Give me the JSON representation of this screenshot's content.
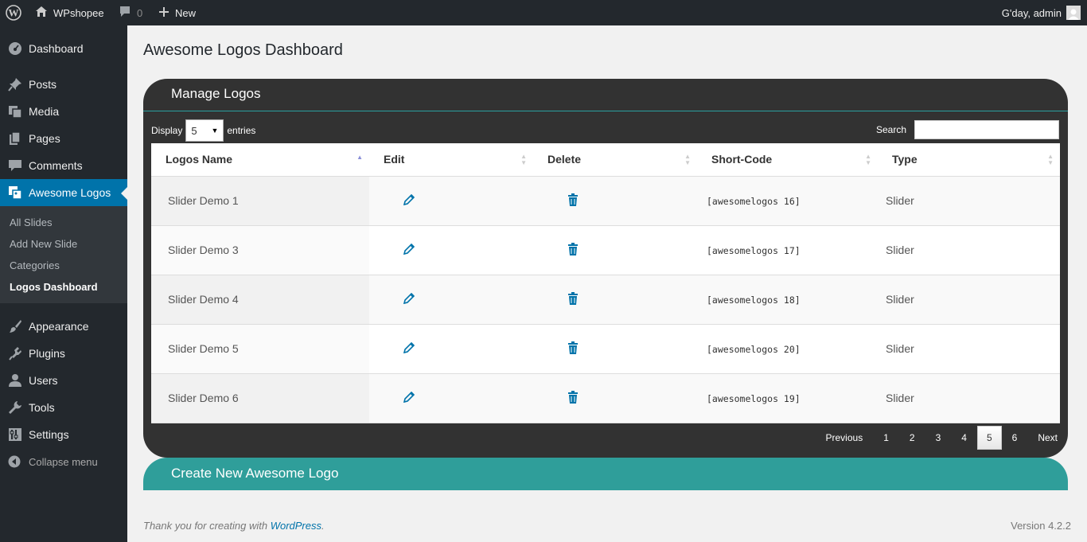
{
  "adminbar": {
    "site_name": "WPshopee",
    "comments_count": "0",
    "new_label": "New",
    "greeting": "G'day, admin"
  },
  "sidebar": {
    "items": [
      {
        "label": "Dashboard",
        "icon": "dashboard-icon"
      },
      {
        "label": "Posts",
        "icon": "pin-icon"
      },
      {
        "label": "Media",
        "icon": "media-icon"
      },
      {
        "label": "Pages",
        "icon": "pages-icon"
      },
      {
        "label": "Comments",
        "icon": "comment-icon"
      },
      {
        "label": "Awesome Logos",
        "icon": "images-icon"
      },
      {
        "label": "Appearance",
        "icon": "brush-icon"
      },
      {
        "label": "Plugins",
        "icon": "plugin-icon"
      },
      {
        "label": "Users",
        "icon": "users-icon"
      },
      {
        "label": "Tools",
        "icon": "wrench-icon"
      },
      {
        "label": "Settings",
        "icon": "settings-icon"
      }
    ],
    "submenu": [
      "All Slides",
      "Add New Slide",
      "Categories",
      "Logos Dashboard"
    ],
    "collapse_label": "Collapse menu"
  },
  "main": {
    "title": "Awesome Logos Dashboard",
    "manage_heading": "Manage Logos",
    "display_label": "Display",
    "display_value": "5",
    "entries_label": "entries",
    "search_label": "Search",
    "columns": [
      "Logos Name",
      "Edit",
      "Delete",
      "Short-Code",
      "Type"
    ],
    "rows": [
      {
        "name": "Slider Demo 1",
        "shortcode": "[awesomelogos 16]",
        "type": "Slider"
      },
      {
        "name": "Slider Demo 3",
        "shortcode": "[awesomelogos 17]",
        "type": "Slider"
      },
      {
        "name": "Slider Demo 4",
        "shortcode": "[awesomelogos 18]",
        "type": "Slider"
      },
      {
        "name": "Slider Demo 5",
        "shortcode": "[awesomelogos 20]",
        "type": "Slider"
      },
      {
        "name": "Slider Demo 6",
        "shortcode": "[awesomelogos 19]",
        "type": "Slider"
      }
    ],
    "pagination": {
      "previous": "Previous",
      "pages": [
        "1",
        "2",
        "3",
        "4",
        "5",
        "6"
      ],
      "current": "5",
      "next": "Next"
    },
    "create_heading": "Create New Awesome Logo"
  },
  "footer": {
    "thanks_prefix": "Thank you for creating with ",
    "thanks_link": "WordPress",
    "thanks_suffix": ".",
    "version": "Version 4.2.2"
  },
  "colors": {
    "admin_dark": "#23282d",
    "active_blue": "#0073aa",
    "panel_dark": "#323232",
    "teal": "#2f9e9a"
  }
}
